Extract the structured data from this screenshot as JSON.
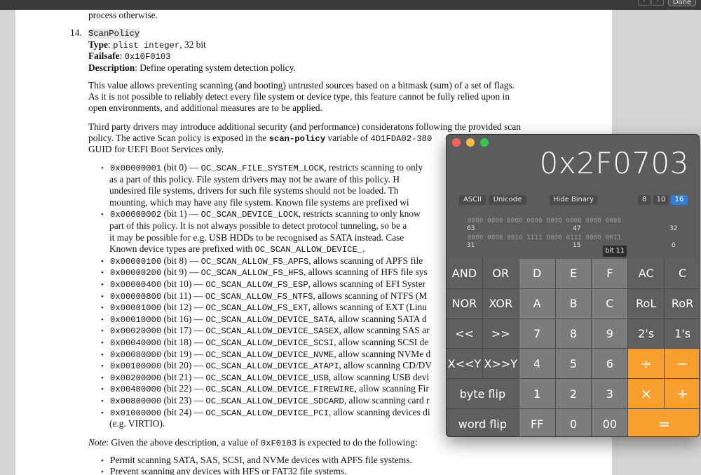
{
  "viewer": {
    "prev_icon": "‹",
    "next_icon": "›",
    "done_label": "Done"
  },
  "doc": {
    "line_top": "process otherwise.",
    "item_number": "14.",
    "item_name": "ScanPolicy",
    "type_label": "Type",
    "type_value_code": "plist integer",
    "type_value_rest": ", 32 bit",
    "failsafe_label": "Failsafe",
    "failsafe_value": "0x10F0103",
    "desc_label": "Description",
    "desc_value": ": Define operating system detection policy.",
    "para1": [
      "This value allows preventing scanning (and booting) untrusted sources based on a bitmask (sum) of a set of flags.",
      "As it is not possible to reliably detect every file system or device type, this feature cannot be fully relied upon in",
      "open environments, and additional measures are to be applied."
    ],
    "para2": [
      {
        "text": "Third party drivers may introduce additional security (and performance) consideratons following the provided scan"
      },
      {
        "pre": "policy.  The active Scan policy is exposed in the ",
        "code": "scan-policy",
        "post": " variable of ",
        "code2": "4D1FDA02-380"
      },
      {
        "text": "GUID for UEFI Boot Services only."
      }
    ],
    "flags": [
      {
        "val": "0x00000001",
        "bit": " (bit 0) — ",
        "name": "OC_SCAN_FILE_SYSTEM_LOCK",
        "desc": ", restricts scanning to only"
      },
      {
        "indent": "as a part of this policy. File system drivers may not be aware of this policy. H"
      },
      {
        "indent": "undesired file systems, drivers for such file systems should not be loaded. Th"
      },
      {
        "indent": "mounting, which may have any file system. Known file systems are prefixed wi"
      },
      {
        "val": "0x00000002",
        "bit": " (bit 1) — ",
        "name": "OC_SCAN_DEVICE_LOCK",
        "desc": ", restricts scanning to only know"
      },
      {
        "indent": "part of this policy. It is not always possible to detect protocol tunneling, so be a"
      },
      {
        "indent": "it may be possible for e.g. USB HDDs to be recognised as SATA instead. Case"
      },
      {
        "indent_pre": "Known device types are prefixed with ",
        "indent_code": "OC_SCAN_ALLOW_DEVICE_",
        "indent_post": "."
      },
      {
        "val": "0x00000100",
        "bit": " (bit 8) — ",
        "name": "OC_SCAN_ALLOW_FS_APFS",
        "desc": ", allows scanning of APFS file"
      },
      {
        "val": "0x00000200",
        "bit": " (bit 9) — ",
        "name": "OC_SCAN_ALLOW_FS_HFS",
        "desc": ", allows scanning of HFS file sys"
      },
      {
        "val": "0x00000400",
        "bit": " (bit 10) — ",
        "name": "OC_SCAN_ALLOW_FS_ESP",
        "desc": ", allows scanning of EFI Syster"
      },
      {
        "val": "0x00000800",
        "bit": " (bit 11) — ",
        "name": "OC_SCAN_ALLOW_FS_NTFS",
        "desc": ", allows scanning of NTFS (M"
      },
      {
        "val": "0x00001000",
        "bit": " (bit 12) — ",
        "name": "OC_SCAN_ALLOW_FS_EXT",
        "desc": ", allows scanning of EXT (Linu"
      },
      {
        "val": "0x00010000",
        "bit": " (bit 16) — ",
        "name": "OC_SCAN_ALLOW_DEVICE_SATA",
        "desc": ", allow scanning SATA d"
      },
      {
        "val": "0x00020000",
        "bit": " (bit 17) — ",
        "name": "OC_SCAN_ALLOW_DEVICE_SASEX",
        "desc": ", allow scanning SAS ar"
      },
      {
        "val": "0x00040000",
        "bit": " (bit 18) — ",
        "name": "OC_SCAN_ALLOW_DEVICE_SCSI",
        "desc": ", allow scanning SCSI de"
      },
      {
        "val": "0x00080000",
        "bit": " (bit 19) — ",
        "name": "OC_SCAN_ALLOW_DEVICE_NVME",
        "desc": ", allow scanning NVMe d"
      },
      {
        "val": "0x00100000",
        "bit": " (bit 20) — ",
        "name": "OC_SCAN_ALLOW_DEVICE_ATAPI",
        "desc": ", allow scanning CD/DV"
      },
      {
        "val": "0x00200000",
        "bit": " (bit 21) — ",
        "name": "OC_SCAN_ALLOW_DEVICE_USB",
        "desc": ", allow scanning USB devi"
      },
      {
        "val": "0x00400000",
        "bit": " (bit 22) — ",
        "name": "OC_SCAN_ALLOW_DEVICE_FIREWIRE",
        "desc": ", allow scanning Fir"
      },
      {
        "val": "0x00800000",
        "bit": " (bit 23) — ",
        "name": "OC_SCAN_ALLOW_DEVICE_SDCARD",
        "desc": ", allow scanning card r"
      },
      {
        "val": "0x01000000",
        "bit": " (bit 24) — ",
        "name": "OC_SCAN_ALLOW_DEVICE_PCI",
        "desc": ", allow scanning devices di"
      },
      {
        "indent": "(e.g. VIRTIO)."
      }
    ],
    "note_label": "Note",
    "note_pre": ": Given the above description, a value of ",
    "note_code": "0xF0103",
    "note_post": " is expected to do the following:",
    "bottom_bullets": [
      "Permit scanning SATA, SAS, SCSI, and NVMe devices with APFS file systems.",
      "Prevent scanning any devices with HFS or FAT32 file systems."
    ]
  },
  "calculator": {
    "display": "0x2F0703",
    "btn_ascii": "ASCII",
    "btn_unicode": "Unicode",
    "btn_hide_binary": "Hide Binary",
    "base_8": "8",
    "base_10": "10",
    "base_16": "16",
    "selected_base": "16",
    "bits_hi": "0000 0000 0000 0000 0000 0000 0000 0000",
    "bits_lo": "0000 0000 0010 1111 0000 0111 0000 0011",
    "bitnum_63": "63",
    "bitnum_47": "47",
    "bitnum_32": "32",
    "bitnum_31": "31",
    "bitnum_15": "15",
    "bitnum_0": "0",
    "tooltip": "bit 11",
    "keys": [
      [
        "AND",
        "OR",
        "D",
        "E",
        "F",
        "AC",
        "C"
      ],
      [
        "NOR",
        "XOR",
        "A",
        "B",
        "C",
        "RoL",
        "RoR"
      ],
      [
        "<<",
        ">>",
        "7",
        "8",
        "9",
        "2's",
        "1's"
      ],
      [
        "X<<Y",
        "X>>Y",
        "4",
        "5",
        "6",
        "÷",
        "−"
      ],
      [
        "byte flip",
        "1",
        "2",
        "3",
        "×",
        "+"
      ],
      [
        "word flip",
        "FF",
        "0",
        "00",
        "="
      ]
    ]
  }
}
